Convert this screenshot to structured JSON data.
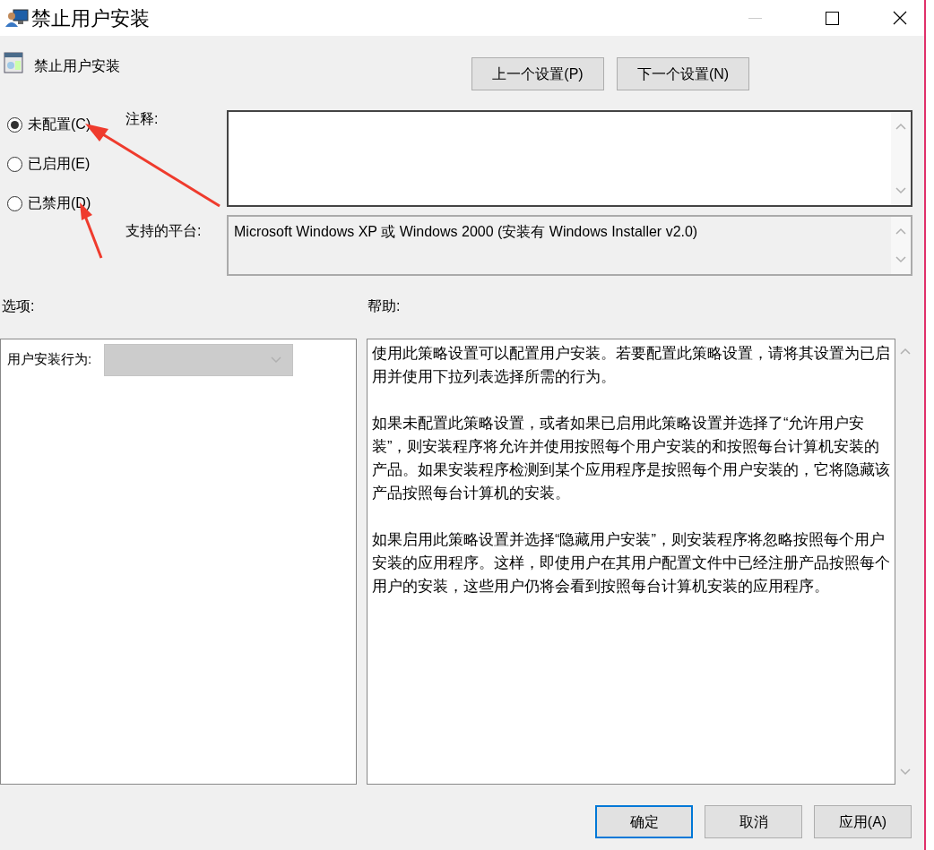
{
  "window": {
    "title": "禁止用户安装"
  },
  "header": {
    "title": "禁止用户安装"
  },
  "nav_buttons": [
    "上一个设置(P)",
    "下一个设置(N)"
  ],
  "radios": [
    {
      "label": "未配置(C)",
      "selected": true
    },
    {
      "label": "已启用(E)",
      "selected": false
    },
    {
      "label": "已禁用(D)",
      "selected": false
    }
  ],
  "comment": {
    "label": "注释:"
  },
  "platform": {
    "label": "支持的平台:",
    "value": "Microsoft Windows XP 或 Windows 2000 (安装有 Windows Installer v2.0)"
  },
  "options": {
    "label": "选项:",
    "dropdown_label": "用户安装行为:",
    "disabled": true
  },
  "help": {
    "label": "帮助:",
    "paragraphs": [
      "使用此策略设置可以配置用户安装。若要配置此策略设置，请将其设置为已启用并使用下拉列表选择所需的行为。",
      "如果未配置此策略设置，或者如果已启用此策略设置并选择了“允许用户安装”，则安装程序将允许并使用按照每个用户安装的和按照每台计算机安装的产品。如果安装程序检测到某个应用程序是按照每个用户安装的，它将隐藏该产品按照每台计算机的安装。",
      "如果启用此策略设置并选择“隐藏用户安装”，则安装程序将忽略按照每个用户安装的应用程序。这样，即使用户在其用户配置文件中已经注册产品按照每个用户的安装，这些用户仍将会看到按照每台计算机安装的应用程序。"
    ]
  },
  "buttons": [
    {
      "label": "确定",
      "kind": "default"
    },
    {
      "label": "取消",
      "kind": "normal"
    },
    {
      "label": "应用(A)",
      "kind": "normal"
    }
  ]
}
